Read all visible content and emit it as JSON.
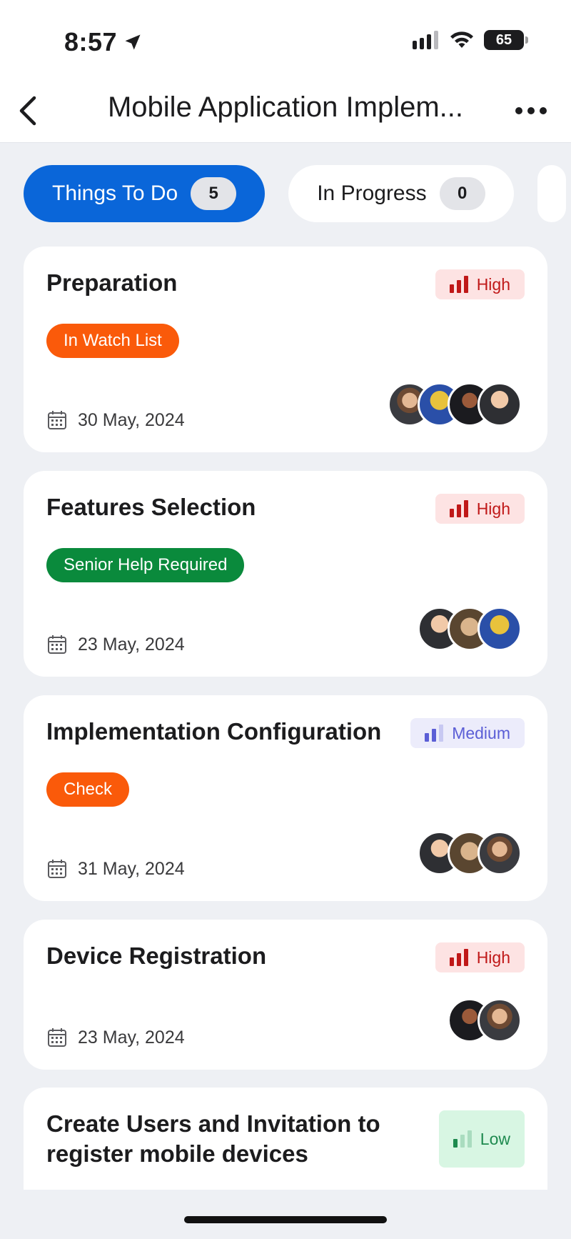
{
  "status_bar": {
    "time": "8:57",
    "battery": "65"
  },
  "header": {
    "title": "Mobile Application Implem..."
  },
  "tabs": [
    {
      "label": "Things To Do",
      "count": "5",
      "active": true
    },
    {
      "label": "In Progress",
      "count": "0",
      "active": false
    }
  ],
  "cards": [
    {
      "title": "Preparation",
      "priority": "High",
      "tag": "In Watch List",
      "date": "30 May, 2024"
    },
    {
      "title": "Features Selection",
      "priority": "High",
      "tag": "Senior Help Required",
      "date": "23 May, 2024"
    },
    {
      "title": "Implementation Configuration",
      "priority": "Medium",
      "tag": "Check",
      "date": "31 May, 2024"
    },
    {
      "title": "Device Registration",
      "priority": "High",
      "date": "23 May, 2024"
    },
    {
      "title_line1": "Create Users and Invitation to",
      "title_line2": "register mobile devices",
      "priority": "Low"
    }
  ],
  "colors": {
    "primary": "#0a66d9",
    "high": "#c01818",
    "medium": "#5b5ed6",
    "low": "#1e8a4f",
    "tag_orange": "#fa5a0a",
    "tag_green": "#0a8a3c"
  },
  "icons": [
    "location-arrow-icon",
    "signal-icon",
    "wifi-icon",
    "battery-icon",
    "back-chevron-icon",
    "more-icon",
    "priority-bars-icon",
    "calendar-icon"
  ]
}
